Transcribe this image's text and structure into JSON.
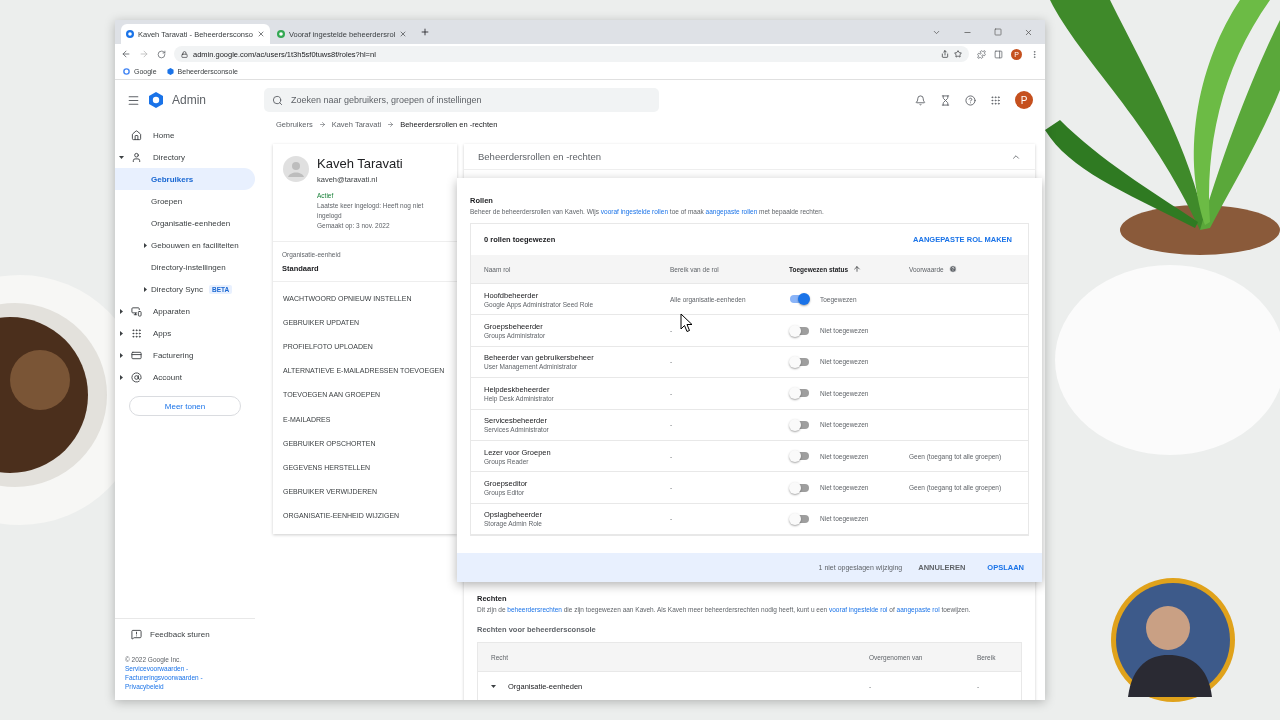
{
  "browser": {
    "tabs": [
      {
        "title": "Kaveh Taravati - Beheerdersconso",
        "selected": true
      },
      {
        "title": "Vooraf ingestelde beheerdersrol",
        "selected": false
      }
    ],
    "url": "admin.google.com/ac/users/1t3h5sf0tuws8f/roles?hl=nl",
    "bookmarks": [
      "Google",
      "Beheerdersconsole"
    ],
    "profile_initial": "P"
  },
  "app": {
    "name": "Admin",
    "search": {
      "placeholder": "Zoeken naar gebruikers, groepen of instellingen"
    },
    "avatar_initial": "P"
  },
  "breadcrumb": [
    "Gebruikers",
    "Kaveh Taravati",
    "Beheerdersrollen en -rechten"
  ],
  "sidebar": {
    "items": [
      {
        "label": "Home",
        "selected": false
      },
      {
        "label": "Directory",
        "selected": false,
        "expanded": true,
        "children": [
          {
            "label": "Gebruikers",
            "selected": true
          },
          {
            "label": "Groepen",
            "selected": false
          },
          {
            "label": "Organisatie-eenheden",
            "selected": false
          },
          {
            "label": "Gebouwen en faciliteiten",
            "selected": false,
            "expanded": false
          },
          {
            "label": "Directory-instellingen",
            "selected": false
          },
          {
            "label": "Directory Sync",
            "selected": false,
            "expanded": false,
            "badge": "BETA"
          }
        ]
      },
      {
        "label": "Apparaten",
        "selected": false,
        "expanded": false
      },
      {
        "label": "Apps",
        "selected": false,
        "expanded": false
      },
      {
        "label": "Facturering",
        "selected": false,
        "expanded": false
      },
      {
        "label": "Account",
        "selected": false,
        "expanded": false
      }
    ],
    "more_button": "Meer tonen",
    "feedback": "Feedback sturen",
    "copyright": "© 2022 Google Inc.",
    "footer_links": [
      "Servicevoorwaarden -",
      "Factureringsvoorwaarden -",
      "Privacybeleid"
    ]
  },
  "user": {
    "name": "Kaveh Taravati",
    "email": "kaveh@taravati.nl",
    "status": "Actief",
    "last_login": "Laatste keer ingelogd: Heeft nog niet ingelogd",
    "created": "Gemaakt op: 3 nov. 2022",
    "org_unit_label": "Organisatie-eenheid",
    "org_unit": "Standaard",
    "actions": [
      "WACHTWOORD OPNIEUW INSTELLEN",
      "GEBRUIKER UPDATEN",
      "PROFIELFOTO UPLOADEN",
      "ALTERNATIEVE E-MAILADRESSEN TOEVOEGEN",
      "TOEVOEGEN AAN GROEPEN",
      "E-MAILADRES",
      "GEBRUIKER OPSCHORTEN",
      "GEGEVENS HERSTELLEN",
      "GEBRUIKER VERWIJDEREN",
      "ORGANISATIE-EENHEID WIJZIGEN"
    ]
  },
  "panel": {
    "title": "Beheerdersrollen en -rechten",
    "expanded": true,
    "roles": {
      "title": "Rollen",
      "description": [
        {
          "text": "Beheer de beheerdersrollen van Kaveh. Wijs "
        },
        {
          "text": "vooraf ingestelde rollen",
          "link": true
        },
        {
          "text": " toe of maak "
        },
        {
          "text": "aangepaste rollen",
          "link": true
        },
        {
          "text": " met bepaalde rechten."
        }
      ],
      "count": "0 rollen toegewezen",
      "create_button": "AANGEPASTE ROL MAKEN",
      "columns": [
        {
          "label": "Naam rol",
          "sorted": false
        },
        {
          "label": "Bereik van de rol",
          "sorted": false
        },
        {
          "label": "Toegewezen status",
          "sorted": true
        },
        {
          "label": "Voorwaarde",
          "sorted": false,
          "help": true
        }
      ],
      "rows": [
        {
          "name": "Hoofdbeheerder",
          "subtitle": "Google Apps Administrator Seed Role",
          "scope": "Alle organisatie-eenheden",
          "assigned": true,
          "status": "Toegewezen"
        },
        {
          "name": "Groepsbeheerder",
          "subtitle": "Groups Administrator",
          "scope": "-",
          "assigned": false,
          "status": "Niet toegewezen"
        },
        {
          "name": "Beheerder van gebruikersbeheer",
          "subtitle": "User Management Administrator",
          "scope": "-",
          "assigned": false,
          "status": "Niet toegewezen"
        },
        {
          "name": "Helpdeskbeheerder",
          "subtitle": "Help Desk Administrator",
          "scope": "-",
          "assigned": false,
          "status": "Niet toegewezen"
        },
        {
          "name": "Servicesbeheerder",
          "subtitle": "Services Administrator",
          "scope": "-",
          "assigned": false,
          "status": "Niet toegewezen"
        },
        {
          "name": "Lezer voor Groepen",
          "subtitle": "Groups Reader",
          "scope": "-",
          "assigned": false,
          "status": "Niet toegewezen",
          "condition": "Geen (toegang tot alle groepen)"
        },
        {
          "name": "Groepseditor",
          "subtitle": "Groups Editor",
          "scope": "-",
          "assigned": false,
          "status": "Niet toegewezen",
          "condition": "Geen (toegang tot alle groepen)"
        },
        {
          "name": "Opslagbeheerder",
          "subtitle": "Storage Admin Role",
          "scope": "-",
          "assigned": false,
          "status": "Niet toegewezen"
        }
      ],
      "unsaved": "1 niet opgeslagen wijziging",
      "cancel_button": "ANNULEREN",
      "save_button": "OPSLAAN"
    },
    "rights": {
      "title": "Rechten",
      "description": [
        {
          "text": "Dit zijn de "
        },
        {
          "text": "beheerdersrechten",
          "link": true
        },
        {
          "text": " die zijn toegewezen aan Kaveh. Als Kaveh meer beheerdersrechten nodig heeft, kunt u een "
        },
        {
          "text": "vooraf ingestelde rol",
          "link": true
        },
        {
          "text": " of "
        },
        {
          "text": "aangepaste rol",
          "link": true
        },
        {
          "text": " toewijzen."
        }
      ],
      "subtitle": "Rechten voor beheerdersconsole",
      "columns": [
        "Recht",
        "Overgenomen van",
        "Bereik"
      ],
      "rows": [
        {
          "name": "Organisatie-eenheden",
          "expanded": true,
          "inherited": "-",
          "scope": "-"
        }
      ]
    }
  }
}
